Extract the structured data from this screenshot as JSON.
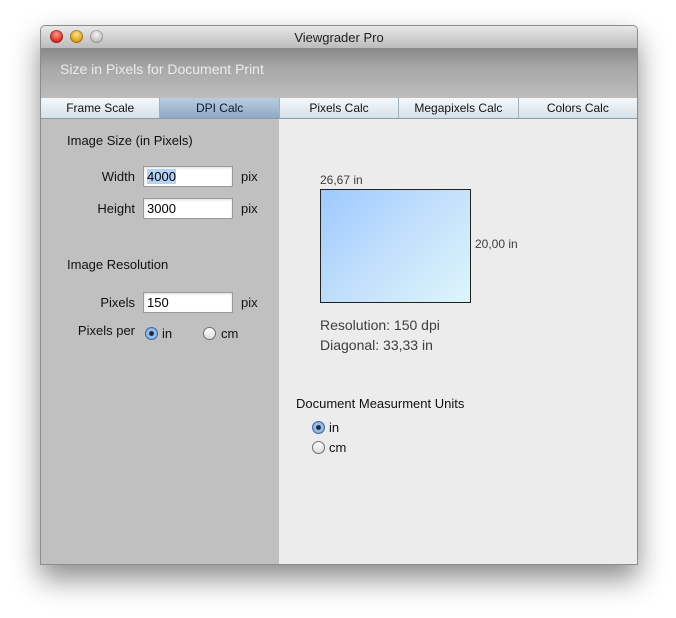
{
  "window": {
    "title": "Viewgrader Pro"
  },
  "header": {
    "banner": "Size in Pixels for Document Print"
  },
  "tabs": [
    {
      "label": "Frame Scale",
      "active": false
    },
    {
      "label": "DPI Calc",
      "active": true
    },
    {
      "label": "Pixels Calc",
      "active": false
    },
    {
      "label": "Megapixels Calc",
      "active": false
    },
    {
      "label": "Colors Calc",
      "active": false
    }
  ],
  "image_size": {
    "heading": "Image Size (in Pixels)",
    "width_label": "Width",
    "width_value": "4000",
    "width_unit": "pix",
    "height_label": "Height",
    "height_value": "3000",
    "height_unit": "pix"
  },
  "image_resolution": {
    "heading": "Image Resolution",
    "pixels_label": "Pixels",
    "pixels_value": "150",
    "pixels_unit": "pix",
    "per_label": "Pixels per",
    "options": [
      {
        "label": "in",
        "selected": true
      },
      {
        "label": "cm",
        "selected": false
      }
    ]
  },
  "preview": {
    "width_text": "26,67  in",
    "height_text": "20,00 in",
    "resolution_text": "Resolution: 150 dpi",
    "diagonal_text": "Diagonal: 33,33 in"
  },
  "document_units": {
    "heading": "Document Measurment Units",
    "options": [
      {
        "label": "in",
        "selected": true
      },
      {
        "label": "cm",
        "selected": false
      }
    ]
  }
}
